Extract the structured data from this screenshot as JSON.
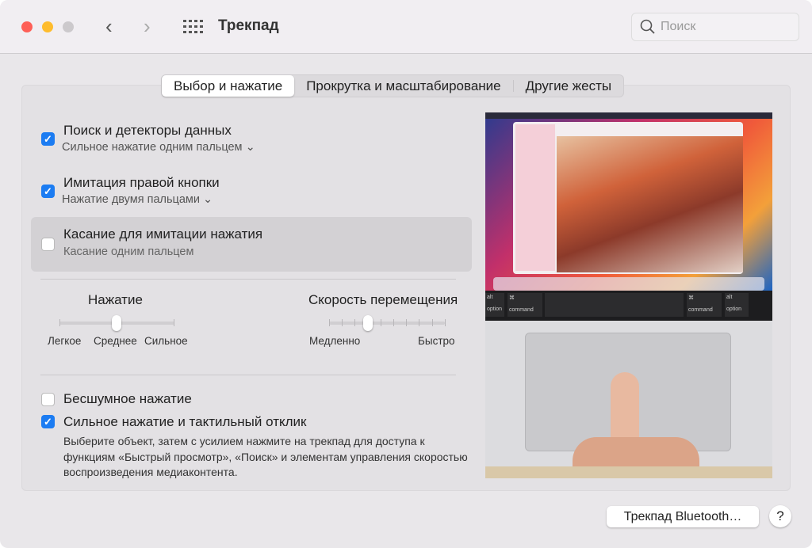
{
  "window": {
    "title": "Трекпад",
    "search_placeholder": "Поиск"
  },
  "tabs": [
    {
      "label": "Выбор и нажатие",
      "active": true
    },
    {
      "label": "Прокрутка и масштабирование"
    },
    {
      "label": "Другие жесты"
    }
  ],
  "options": [
    {
      "label": "Поиск и детекторы данных",
      "sub": "Сильное нажатие одним пальцем",
      "checked": true
    },
    {
      "label": "Имитация правой кнопки",
      "sub": "Нажатие двумя пальцами",
      "checked": true
    },
    {
      "label": "Касание для имитации нажатия",
      "sub": "Касание одним пальцем",
      "checked": false
    }
  ],
  "click_slider": {
    "title": "Нажатие",
    "labels": [
      "Легкое",
      "Среднее",
      "Сильное"
    ],
    "value": 0.5
  },
  "speed_slider": {
    "title": "Скорость перемещения",
    "min_label": "Медленно",
    "max_label": "Быстро",
    "value": 0.333
  },
  "silent": {
    "label": "Бесшумное нажатие",
    "checked": false
  },
  "force": {
    "label": "Сильное нажатие и тактильный отклик",
    "checked": true,
    "description": "Выберите объект, затем с усилием нажмите на трекпад для доступа к функциям «Быстрый просмотр», «Поиск» и элементам управления скоростью воспроизведения медиаконтента."
  },
  "preview": {
    "keys": [
      "alt",
      "option",
      "⌘",
      "command",
      "⌘",
      "command",
      "alt",
      "option"
    ]
  },
  "footer": {
    "bluetooth_button": "Трекпад Bluetooth…",
    "help": "?"
  }
}
